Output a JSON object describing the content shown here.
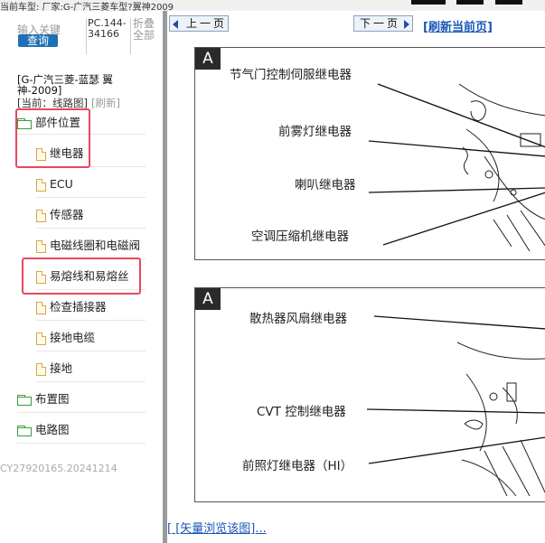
{
  "topbar": {
    "text": "当前车型: 厂家:G-广汽三菱车型?翼神2009"
  },
  "sidebar": {
    "search_hint": "输入关键",
    "query_label": "查询",
    "pc_code": "PC.144-34166",
    "fold_label": "折叠全部",
    "car_title": "[G-广汽三菱-蓝瑟 翼神-2009]",
    "current_prefix": "[当前：线路图]",
    "refresh_label": "[刷新]",
    "folder_open": "部件位置",
    "children": [
      "继电器",
      "ECU",
      "传感器",
      "电磁线圈和电磁阀",
      "易熔线和易熔丝",
      "检查插接器",
      "接地电缆",
      "接地"
    ],
    "folders": [
      "布置图",
      "电路图"
    ],
    "footer_id": "CY27920165.20241214"
  },
  "colors": {
    "link": "#1a56b8",
    "highlight": "#e8485e",
    "button": "#1e6fb3",
    "folder": "#3a9a3a",
    "doc": "#d9a546"
  },
  "main": {
    "prev_label": "上一页",
    "next_label": "下一页",
    "refresh_page": "[刷新当前页]",
    "diagram1": {
      "letter": "A",
      "labels": [
        "节气门控制伺服继电器",
        "前雾灯继电器",
        "喇叭继电器",
        "空调压缩机继电器"
      ]
    },
    "diagram2": {
      "letter": "A",
      "labels": [
        "散热器风扇继电器",
        "CVT 控制继电器",
        "前照灯继电器（HI）"
      ]
    },
    "vector_link": "[ [矢量浏览该图]..."
  }
}
